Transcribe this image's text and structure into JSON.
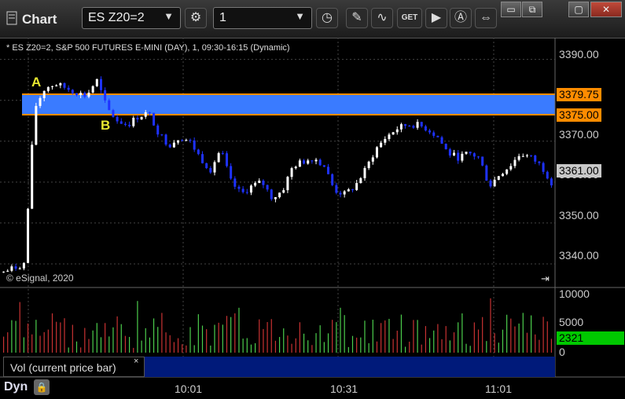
{
  "window": {
    "title": "Chart",
    "symbol": "ES Z20=2",
    "interval": "1",
    "buttons": {
      "minimize": "▭",
      "restore": "⧉",
      "maximize": "▢",
      "close": "✕"
    }
  },
  "toolbar": {
    "icons": [
      "settings-icon",
      "clock-icon",
      "pencil-icon",
      "study-icon",
      "get-icon",
      "play-icon",
      "alert-icon",
      "arrows-icon"
    ],
    "get_label": "GET"
  },
  "chart": {
    "header": "* ES Z20=2, S&P 500 FUTURES E-MINI (DAY), 1, 09:30-16:15 (Dynamic)",
    "copyright": "© eSignal, 2020",
    "price_ticks": [
      "3390.00",
      "3370.00",
      "3360.00",
      "3350.00",
      "3340.00"
    ],
    "level_a": "3379.75",
    "level_b": "3375.00",
    "last_price": "3361.00",
    "label_a": "A",
    "label_b": "B",
    "time_ticks": [
      "10:01",
      "10:31",
      "11:01"
    ],
    "volume_ticks": [
      "10000",
      "5000",
      "0"
    ],
    "last_volume": "2321",
    "volume_study": "Vol (current price bar)",
    "close_glyph": "×",
    "dyn_label": "Dyn",
    "colors": {
      "up": "#ffffff",
      "down": "#1e32ff",
      "band": "#3a7bff",
      "level": "#ff8c00",
      "vol_up": "#4ccd4c",
      "vol_down": "#c83232",
      "last": "#00c800"
    }
  },
  "chart_data": {
    "type": "table",
    "price_range": [
      3335,
      3393
    ],
    "volume_range": [
      0,
      10000
    ],
    "zone": {
      "top": 3379.75,
      "bottom": 3375.0
    },
    "close_path": [
      3338,
      3339,
      3340,
      3378,
      3383,
      3384,
      3383,
      3382,
      3381,
      3385,
      3378,
      3375,
      3374,
      3376,
      3377,
      3372,
      3369,
      3371,
      3370,
      3366,
      3363,
      3368,
      3360,
      3357,
      3359,
      3360,
      3356,
      3358,
      3364,
      3365,
      3366,
      3364,
      3358,
      3357,
      3359,
      3363,
      3368,
      3371,
      3373,
      3374,
      3374,
      3373,
      3371,
      3367,
      3366,
      3367,
      3366,
      3359,
      3362,
      3364,
      3367,
      3366,
      3364,
      3360
    ]
  }
}
